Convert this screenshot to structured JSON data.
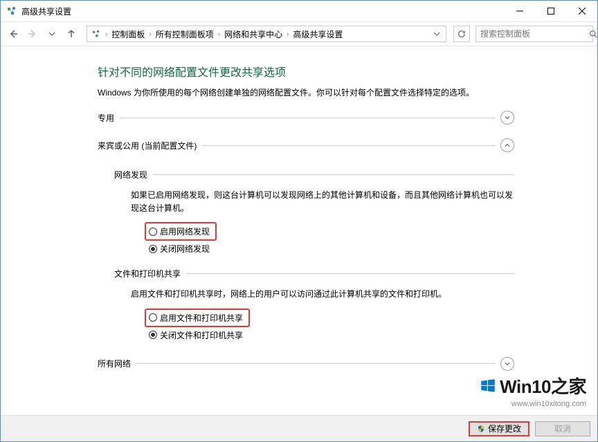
{
  "window": {
    "title": "高级共享设置"
  },
  "breadcrumb": {
    "items": [
      "控制面板",
      "所有控制面板项",
      "网络和共享中心",
      "高级共享设置"
    ]
  },
  "search": {
    "placeholder": "搜索控制面板"
  },
  "page": {
    "title": "针对不同的网络配置文件更改共享选项",
    "description": "Windows 为你所使用的每个网络创建单独的网络配置文件。你可以针对每个配置文件选择特定的选项。"
  },
  "profiles": {
    "private": {
      "label": "专用",
      "expanded": false
    },
    "guest": {
      "label": "来宾或公用 (当前配置文件)",
      "expanded": true,
      "network_discovery": {
        "title": "网络发现",
        "desc": "如果已启用网络发现，则这台计算机可以发现网络上的其他计算机和设备，而且其他网络计算机也可以发现这台计算机。",
        "option_on": "启用网络发现",
        "option_off": "关闭网络发现",
        "selected": "off"
      },
      "file_printer": {
        "title": "文件和打印机共享",
        "desc": "启用文件和打印机共享时，网络上的用户可以访问通过此计算机共享的文件和打印机。",
        "option_on": "启用文件和打印机共享",
        "option_off": "关闭文件和打印机共享",
        "selected": "off"
      }
    },
    "all": {
      "label": "所有网络",
      "expanded": false
    }
  },
  "footer": {
    "save": "保存更改",
    "cancel": "取消"
  },
  "watermark": {
    "main": "Win10之家",
    "url": "www.win10xitong.com"
  }
}
